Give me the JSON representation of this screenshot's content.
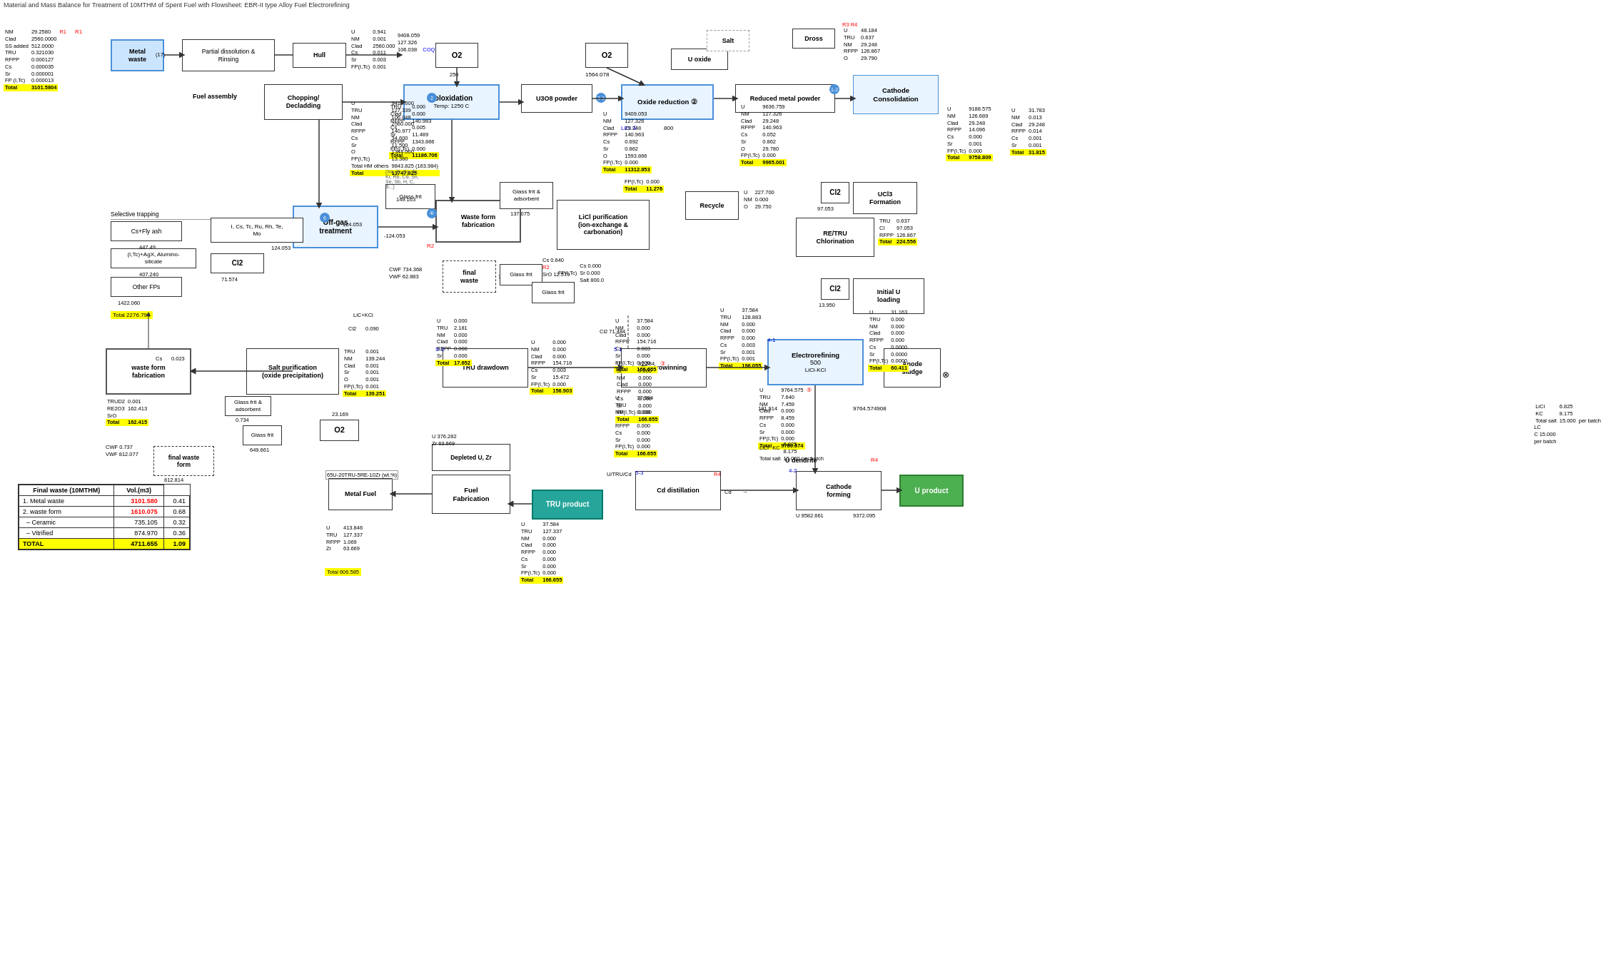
{
  "title": "Material and Mass Balance for Treatment of 10MTHM of Spent Fuel with Flowsheet: EBR-II type Alloy Fuel Electrorefining",
  "processes": {
    "metal_waste": {
      "label": "Metal\nwaste",
      "id": "metal-waste"
    },
    "chopping": {
      "label": "Chopping/\nDecladding",
      "id": "chopping"
    },
    "hull": {
      "label": "Hull",
      "id": "hull"
    },
    "partial_dissolution": {
      "label": "Partial dissolution &\nRinsing",
      "id": "partial-dissolution"
    },
    "voloxidation": {
      "label": "Voloxidation\nTemp: 1250 C",
      "id": "voloxidation"
    },
    "u3o8": {
      "label": "U3O8 powder",
      "id": "u3o8"
    },
    "oxide_reduction": {
      "label": "Oxide reduction ②",
      "id": "oxide-reduction"
    },
    "reduced_metal": {
      "label": "Reduced metal powder",
      "id": "reduced-metal"
    },
    "cathode_consolidation": {
      "label": "Cathode\nConsolidation",
      "id": "cathode-consolidation"
    },
    "offgas": {
      "label": "Off-gas\ntreatment",
      "id": "offgas"
    },
    "waste_form_fab1": {
      "label": "Waste form\nfabrication",
      "id": "waste-form-fab1"
    },
    "waste_form_fab2": {
      "label": "waste form\nfabrication",
      "id": "waste-form-fab2"
    },
    "lici_purification": {
      "label": "LiCl purification\n(ion-exchange &\ncarbonation)",
      "id": "lici-purification"
    },
    "salt_purification": {
      "label": "Salt purification\n(oxide precipitation)",
      "id": "salt-purification"
    },
    "tru_drawdown": {
      "label": "TRU drawdown",
      "id": "tru-drawdown"
    },
    "electrowinning": {
      "label": "Electrowinning",
      "id": "electrowinning"
    },
    "electrorefining": {
      "label": "Electrorefining\n500",
      "id": "electrorefining"
    },
    "cathode_forming": {
      "label": "Cathode\nforming",
      "id": "cathode-forming"
    },
    "anode_sludge": {
      "label": "Anode\nsludge",
      "id": "anode-sludge"
    },
    "cd_distillation": {
      "label": "Cd distillation",
      "id": "cd-distillation"
    },
    "fuel_fabrication": {
      "label": "Fuel\nFabrication",
      "id": "fuel-fabrication"
    },
    "metal_fuel": {
      "label": "Metal Fuel",
      "id": "metal-fuel"
    },
    "tru_product": {
      "label": "TRU product",
      "id": "tru-product"
    },
    "u_product": {
      "label": "U product",
      "id": "u-product"
    },
    "recycle": {
      "label": "Recycle",
      "id": "recycle"
    },
    "re_tru_chlorination": {
      "label": "RE/TRU\nChlorination",
      "id": "re-tru-chlorination"
    },
    "uci3_formation": {
      "label": "UCl3\nFormation",
      "id": "uci3-formation"
    },
    "initial_u_loading": {
      "label": "Initial U\nloading",
      "id": "initial-u-loading"
    },
    "fuel_assembly": {
      "label": "Fuel assembly",
      "id": "fuel-assembly"
    },
    "cs_fly_ash": {
      "label": "Cs+Fly ash",
      "id": "cs-fly-ash"
    },
    "cl2_box": {
      "label": "Cl2",
      "id": "cl2-box"
    },
    "i_cs_tc": {
      "label": "I, Cs, Tc, Ru, Rh, Te,\nMo",
      "id": "i-cs-tc"
    },
    "other_fps": {
      "label": "Other FPs",
      "id": "other-fps"
    },
    "dross": {
      "label": "Dross",
      "id": "dross"
    },
    "glass_frit1": {
      "label": "Glass frit",
      "id": "glass-frit1"
    },
    "glass_frit2": {
      "label": "Glass frit &\nadsorbent",
      "id": "glass-frit2"
    },
    "glass_frit3": {
      "label": "Glass frit &\nadsorbent",
      "id": "glass-frit3"
    },
    "glass_frit4": {
      "label": "Glass frit",
      "id": "glass-frit4"
    },
    "glass_frit5": {
      "label": "Glass frit",
      "id": "glass-frit5"
    },
    "o2_1": {
      "label": "O2",
      "id": "o2-1"
    },
    "o2_2": {
      "label": "O2",
      "id": "o2-2"
    },
    "o2_3": {
      "label": "O2",
      "id": "o2-3"
    },
    "final_waste1": {
      "label": "final\nwaste",
      "id": "final-waste1"
    },
    "final_waste2": {
      "label": "final waste\nform",
      "id": "final-waste2"
    },
    "salt_box": {
      "label": "Salt",
      "id": "salt-box"
    },
    "u_oxide": {
      "label": "U oxide",
      "id": "u-oxide"
    },
    "depleted_u_zr": {
      "label": "Depleted U, Zr",
      "id": "depleted-u-zr"
    }
  },
  "final_waste_table": {
    "title": "Final waste (10MTHM)",
    "vol_header": "Vol.(m3)",
    "rows": [
      {
        "label": "1. Metal waste",
        "value": "3101.580",
        "vol": "0.41"
      },
      {
        "label": "2. waste form",
        "value": "1610.075",
        "vol": "0.68"
      },
      {
        "label": "– Ceramic",
        "value": "735.105",
        "vol": "0.32"
      },
      {
        "label": "– Vitrified",
        "value": "874.970",
        "vol": "0.36"
      }
    ],
    "total_label": "TOTAL",
    "total_value": "4711.655",
    "total_vol": "1.09"
  },
  "colors": {
    "yellow": "#ffff00",
    "cyan": "#00ffff",
    "green": "#4CAF50",
    "teal": "#26a69a",
    "blue_border": "#4a90d9",
    "red": "#cc0000"
  }
}
